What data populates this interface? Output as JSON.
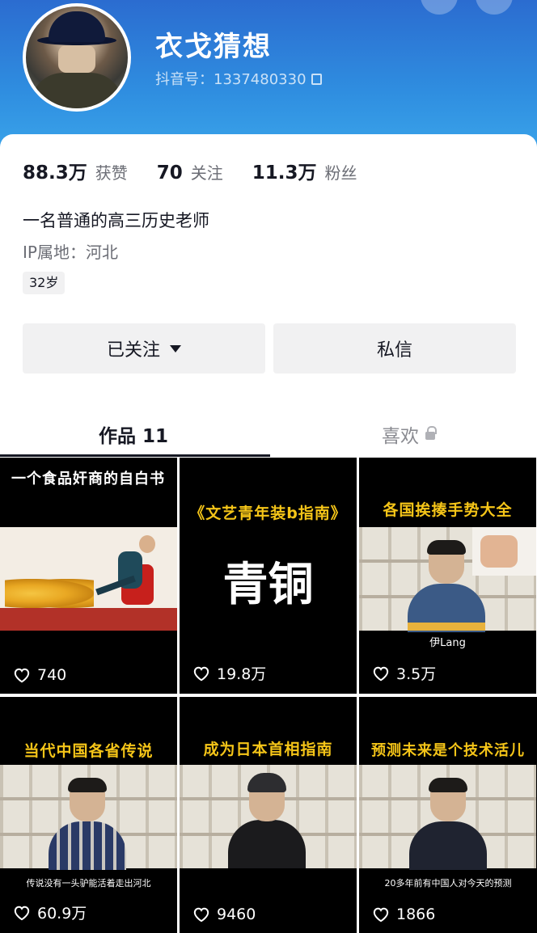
{
  "profile": {
    "name": "衣戈猜想",
    "douyin_id": "抖音号：1337480330",
    "stats": [
      {
        "num": "88.3万",
        "label": "获赞"
      },
      {
        "num": "70",
        "label": "关注"
      },
      {
        "num": "11.3万",
        "label": "粉丝"
      }
    ],
    "bio": "一名普通的高三历史老师",
    "ip": "IP属地：河北",
    "age": "32岁"
  },
  "buttons": {
    "follow": "已关注",
    "message": "私信"
  },
  "tabs": {
    "works": "作品 11",
    "likes": "喜欢"
  },
  "videos": [
    {
      "title": "一个食品奸商的自白书",
      "subtitle": "",
      "likes": "740",
      "title_color": "#ffffff"
    },
    {
      "title": "《文艺青年装b指南》",
      "subtitle": "",
      "big_text": "青铜",
      "likes": "19.8万",
      "title_color": "#f5c518"
    },
    {
      "title": "各国挨揍手势大全",
      "subtitle": "伊Lang",
      "likes": "3.5万",
      "title_color": "#f5c518"
    },
    {
      "title": "当代中国各省传说",
      "subtitle": "传说没有一头驴能活着走出河北",
      "likes": "60.9万",
      "title_color": "#f5c518"
    },
    {
      "title": "成为日本首相指南",
      "subtitle": "",
      "likes": "9460",
      "title_color": "#f5c518"
    },
    {
      "title": "预测未来是个技术活儿",
      "subtitle": "20多年前有中国人对今天的预测",
      "likes": "1866",
      "title_color": "#f5c518"
    }
  ],
  "colors": {
    "header_top": "#2b6cd0",
    "header_bottom": "#3aa4ea",
    "accent_yellow": "#f5c518"
  }
}
